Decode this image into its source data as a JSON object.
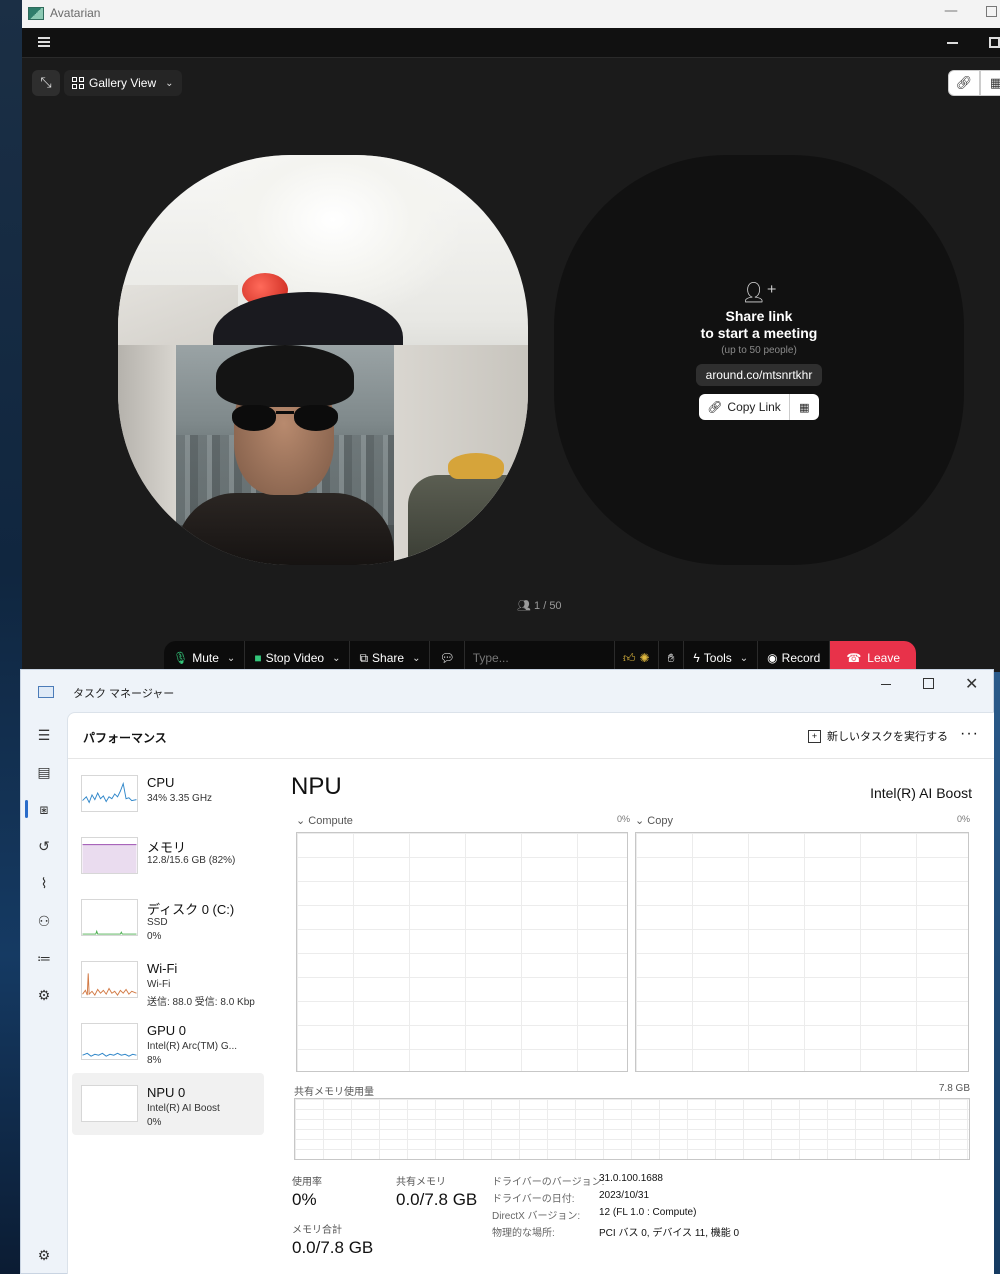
{
  "avatarian": {
    "window_title": "Avatarian",
    "view_mode": "Gallery View",
    "invite": {
      "title_line1": "Share link",
      "title_line2": "to start a meeting",
      "subtitle": "(up to 50 people)",
      "link": "around.co/mtsnrtkhr",
      "copy_label": "Copy Link"
    },
    "participants": "1 / 50",
    "toolbar": {
      "mute": "Mute",
      "stop_video": "Stop Video",
      "share": "Share",
      "chat_placeholder": "Type...",
      "tools": "Tools",
      "record": "Record",
      "leave": "Leave"
    },
    "colors": {
      "leave": "#e8324a",
      "mic": "#34c77b"
    }
  },
  "task_manager": {
    "window_title": "タスク マネージャー",
    "page_title": "パフォーマンス",
    "run_new_task": "新しいタスクを実行する",
    "devices": [
      {
        "name": "CPU",
        "line2": "34% 3.35 GHz",
        "line3": ""
      },
      {
        "name": "メモリ",
        "line2": "12.8/15.6 GB (82%)",
        "line3": ""
      },
      {
        "name": "ディスク 0 (C:)",
        "line2": "SSD",
        "line3": "0%"
      },
      {
        "name": "Wi-Fi",
        "line2": "Wi-Fi",
        "line3": "送信: 88.0 受信: 8.0 Kbp"
      },
      {
        "name": "GPU 0",
        "line2": "Intel(R) Arc(TM) G...",
        "line3": "8%"
      },
      {
        "name": "NPU 0",
        "line2": "Intel(R) AI Boost",
        "line3": "0%"
      }
    ],
    "selected": {
      "title": "NPU",
      "model": "Intel(R) AI Boost",
      "graph_compute_label": "Compute",
      "graph_compute_pct": "0%",
      "graph_copy_label": "Copy",
      "graph_copy_pct": "0%",
      "shared_memory_label": "共有メモリ使用量",
      "shared_memory_total": "7.8 GB",
      "stats": {
        "utilization_label": "使用率",
        "utilization_value": "0%",
        "shared_mem_label": "共有メモリ",
        "shared_mem_value": "0.0/7.8 GB",
        "mem_total_label": "メモリ合計",
        "mem_total_value": "0.0/7.8 GB"
      },
      "details": [
        {
          "key": "ドライバーのバージョン:",
          "value": "31.0.100.1688"
        },
        {
          "key": "ドライバーの日付:",
          "value": "2023/10/31"
        },
        {
          "key": "DirectX バージョン:",
          "value": "12 (FL 1.0 : Compute)"
        },
        {
          "key": "物理的な場所:",
          "value": "PCI バス 0, デバイス 11, 機能 0"
        }
      ]
    }
  }
}
